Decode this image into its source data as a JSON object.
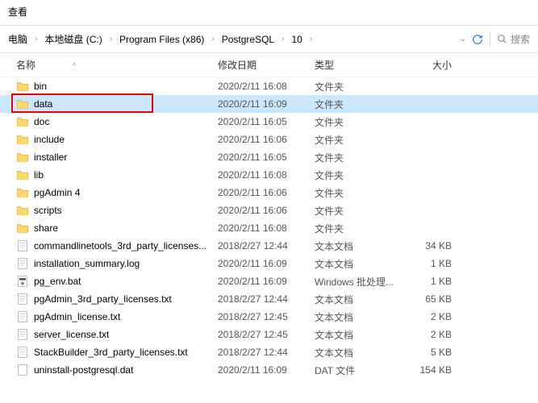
{
  "ribbon": {
    "view_label": "查看"
  },
  "breadcrumb": {
    "items": [
      "电脑",
      "本地磁盘 (C:)",
      "Program Files (x86)",
      "PostgreSQL",
      "10"
    ]
  },
  "search": {
    "placeholder": "搜索"
  },
  "columns": {
    "name": "名称",
    "date": "修改日期",
    "type": "类型",
    "size": "大小"
  },
  "rows": [
    {
      "icon": "folder",
      "name": "bin",
      "date": "2020/2/11 16:08",
      "type": "文件夹",
      "size": ""
    },
    {
      "icon": "folder",
      "name": "data",
      "date": "2020/2/11 16:09",
      "type": "文件夹",
      "size": "",
      "selected": true,
      "highlighted": true
    },
    {
      "icon": "folder",
      "name": "doc",
      "date": "2020/2/11 16:05",
      "type": "文件夹",
      "size": ""
    },
    {
      "icon": "folder",
      "name": "include",
      "date": "2020/2/11 16:06",
      "type": "文件夹",
      "size": ""
    },
    {
      "icon": "folder",
      "name": "installer",
      "date": "2020/2/11 16:05",
      "type": "文件夹",
      "size": ""
    },
    {
      "icon": "folder",
      "name": "lib",
      "date": "2020/2/11 16:08",
      "type": "文件夹",
      "size": ""
    },
    {
      "icon": "folder",
      "name": "pgAdmin 4",
      "date": "2020/2/11 16:06",
      "type": "文件夹",
      "size": ""
    },
    {
      "icon": "folder",
      "name": "scripts",
      "date": "2020/2/11 16:06",
      "type": "文件夹",
      "size": ""
    },
    {
      "icon": "folder",
      "name": "share",
      "date": "2020/2/11 16:08",
      "type": "文件夹",
      "size": ""
    },
    {
      "icon": "text",
      "name": "commandlinetools_3rd_party_licenses...",
      "date": "2018/2/27 12:44",
      "type": "文本文档",
      "size": "34 KB"
    },
    {
      "icon": "text",
      "name": "installation_summary.log",
      "date": "2020/2/11 16:09",
      "type": "文本文档",
      "size": "1 KB"
    },
    {
      "icon": "bat",
      "name": "pg_env.bat",
      "date": "2020/2/11 16:09",
      "type": "Windows 批处理...",
      "size": "1 KB"
    },
    {
      "icon": "text",
      "name": "pgAdmin_3rd_party_licenses.txt",
      "date": "2018/2/27 12:44",
      "type": "文本文档",
      "size": "65 KB"
    },
    {
      "icon": "text",
      "name": "pgAdmin_license.txt",
      "date": "2018/2/27 12:45",
      "type": "文本文档",
      "size": "2 KB"
    },
    {
      "icon": "text",
      "name": "server_license.txt",
      "date": "2018/2/27 12:45",
      "type": "文本文档",
      "size": "2 KB"
    },
    {
      "icon": "text",
      "name": "StackBuilder_3rd_party_licenses.txt",
      "date": "2018/2/27 12:44",
      "type": "文本文档",
      "size": "5 KB"
    },
    {
      "icon": "file",
      "name": "uninstall-postgresql.dat",
      "date": "2020/2/11 16:09",
      "type": "DAT 文件",
      "size": "154 KB"
    }
  ]
}
